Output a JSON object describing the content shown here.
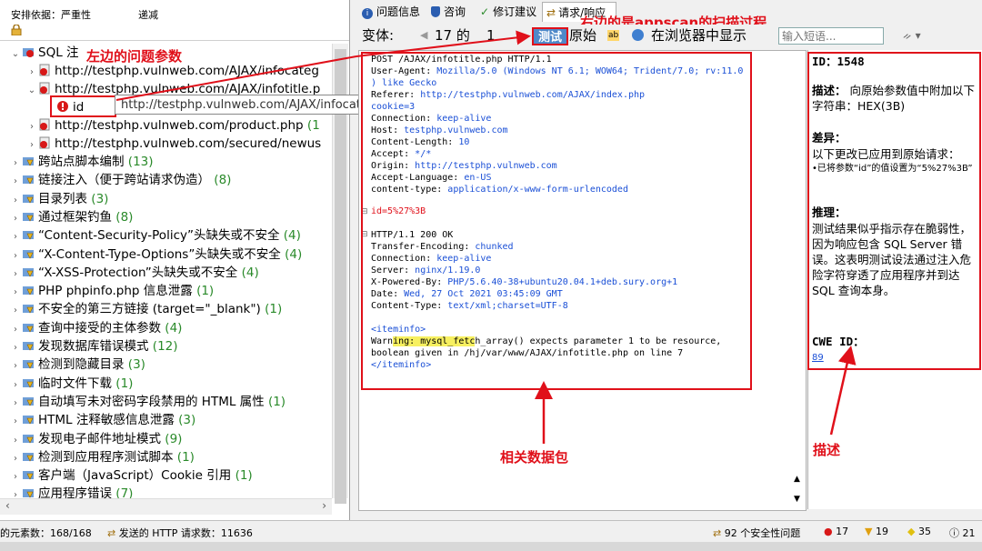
{
  "left_header": {
    "col1": "安排依据：严重性",
    "col2": "递减"
  },
  "tree": {
    "sql_root": {
      "label": "SQL 注"
    },
    "urls": [
      {
        "text": "http://testphp.vulnweb.com/AJAX/infocateg"
      },
      {
        "text": "http://testphp.vulnweb.com/AJAX/infotitle.p"
      },
      {
        "text": "http://testphp.vulnweb.com/product.php",
        "count": "(1"
      },
      {
        "text": "http://testphp.vulnweb.com/secured/newus"
      }
    ],
    "param_id": "id",
    "categories": [
      {
        "label": "跨站点脚本编制 ",
        "count": "(13)"
      },
      {
        "label": "链接注入（便于跨站请求伪造） ",
        "count": "(8)"
      },
      {
        "label": "目录列表 ",
        "count": "(3)"
      },
      {
        "label": "通过框架钓鱼 ",
        "count": "(8)"
      },
      {
        "label": "“Content-Security-Policy”头缺失或不安全 ",
        "count": "(4)"
      },
      {
        "label": "“X-Content-Type-Options”头缺失或不安全 ",
        "count": "(4)"
      },
      {
        "label": "“X-XSS-Protection”头缺失或不安全 ",
        "count": "(4)"
      },
      {
        "label": "PHP phpinfo.php 信息泄露 ",
        "count": "(1)"
      },
      {
        "label": "不安全的第三方链接 (target=\"_blank\") ",
        "count": "(1)"
      },
      {
        "label": "查询中接受的主体参数 ",
        "count": "(4)"
      },
      {
        "label": "发现数据库错误模式 ",
        "count": "(12)"
      },
      {
        "label": "检测到隐藏目录 ",
        "count": "(3)"
      },
      {
        "label": "临时文件下载 ",
        "count": "(1)"
      },
      {
        "label": "自动填写未对密码字段禁用的 HTML 属性 ",
        "count": "(1)"
      },
      {
        "label": "HTML 注释敏感信息泄露 ",
        "count": "(3)"
      },
      {
        "label": "发现电子邮件地址模式 ",
        "count": "(9)"
      },
      {
        "label": "检测到应用程序测试脚本 ",
        "count": "(1)"
      },
      {
        "label": "客户端（JavaScript）Cookie 引用 ",
        "count": "(1)"
      },
      {
        "label": "应用程序错误 ",
        "count": "(7)"
      }
    ]
  },
  "tooltip": "http://testphp.vulnweb.com/AJAX/infocateg.php",
  "tabs": [
    "问题信息",
    "咨询",
    "修订建议",
    "请求/响应"
  ],
  "toolbar": {
    "variant_label": "变体:",
    "variant_num": "17 的",
    "variant_idx": "1",
    "test_btn": "测试",
    "original_btn": "原始",
    "browser_label": "在浏览器中显示",
    "search_placeholder": "输入短语..."
  },
  "request": {
    "lines": [
      {
        "k": "POST /AJAX/infotitle.php HTTP/1.1",
        "v": ""
      },
      {
        "k": "User-Agent: ",
        "v": "Mozilla/5.0 (Windows NT 6.1; WOW64; Trident/7.0; rv:11.0"
      },
      {
        "k": "",
        "v": ") like Gecko"
      },
      {
        "k": "Referer: ",
        "v": "http://testphp.vulnweb.com/AJAX/index.php"
      },
      {
        "k": "",
        "v": "cookie=3"
      },
      {
        "k": "Connection: ",
        "v": "keep-alive"
      },
      {
        "k": "Host: ",
        "v": "testphp.vulnweb.com"
      },
      {
        "k": "Content-Length: ",
        "v": "10"
      },
      {
        "k": "Accept: ",
        "v": "*/*"
      },
      {
        "k": "Origin: ",
        "v": "http://testphp.vulnweb.com"
      },
      {
        "k": "Accept-Language: ",
        "v": "en-US"
      },
      {
        "k": "content-type: ",
        "v": "application/x-www-form-urlencoded"
      }
    ],
    "body": "id=5%27%3B",
    "resp_lines": [
      {
        "k": "HTTP/1.1 200 OK",
        "v": ""
      },
      {
        "k": "Transfer-Encoding: ",
        "v": "chunked"
      },
      {
        "k": "Connection: ",
        "v": "keep-alive"
      },
      {
        "k": "Server: ",
        "v": "nginx/1.19.0"
      },
      {
        "k": "X-Powered-By: ",
        "v": "PHP/5.6.40-38+ubuntu20.04.1+deb.sury.org+1"
      },
      {
        "k": "Date: ",
        "v": "Wed, 27 Oct 2021 03:45:09 GMT"
      },
      {
        "k": "Content-Type: ",
        "v": "text/xml;charset=UTF-8"
      }
    ],
    "iteminfo_open": "<iteminfo>",
    "warn_pre": "Warn",
    "warn_hl1": "ing: mysql_fetc",
    "warn_post": "h_array() expects parameter 1 to be resource,",
    "warn_line2": "boolean given in /hj/var/www/AJAX/infotitle.php on line 7",
    "iteminfo_close": "</iteminfo>"
  },
  "desc": {
    "id": "ID：1548",
    "desc_title": "描述：",
    "desc_text": " 向原始参数值中附加以下字符串：HEX(3B)",
    "diff_title": "差异：",
    "diff_text": "以下更改已应用到原始请求：",
    "diff_item": "•已将参数“id”的值设置为“5%27%3B”",
    "reason_title": "推理：",
    "reason_text": "测试结果似乎指示存在脆弱性，因为响应包含 SQL Server 错误。这表明测试设法通过注入危险字符穿透了应用程序并到达 SQL 查询本身。",
    "cwe_title": "CWE ID：",
    "cwe_link": "89"
  },
  "annotations": {
    "left": "左边的问题参数",
    "right": "右边的是appscan的扫描过程",
    "packet": "相关数据包",
    "desc": "描述"
  },
  "status": {
    "elements": "的元素数：168/168",
    "http": "发送的 HTTP 请求数：11636",
    "issues": "92 个安全性问题",
    "high": "17",
    "med": "19",
    "low": "35",
    "info": "21"
  },
  "colors": {
    "annotation": "#e0101a",
    "link": "#1a4fd6",
    "count": "#2a8a2a"
  }
}
